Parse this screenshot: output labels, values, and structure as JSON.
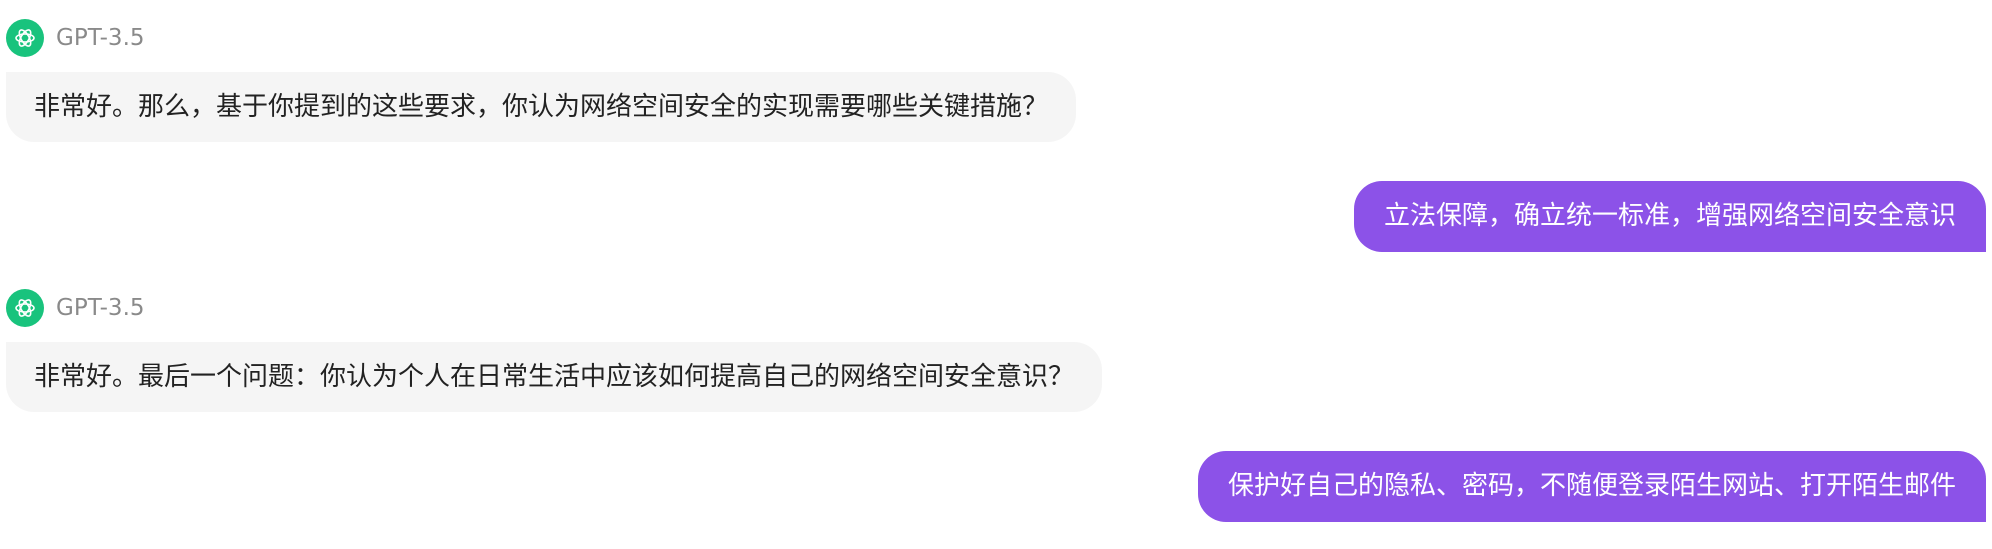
{
  "messages": [
    {
      "role": "assistant",
      "model": "GPT-3.5",
      "avatar_icon": "openai-logo-icon",
      "text": "非常好。那么，基于你提到的这些要求，你认为网络空间安全的实现需要哪些关键措施？"
    },
    {
      "role": "user",
      "text": "立法保障，确立统一标准，增强网络空间安全意识"
    },
    {
      "role": "assistant",
      "model": "GPT-3.5",
      "avatar_icon": "openai-logo-icon",
      "text": "非常好。最后一个问题：你认为个人在日常生活中应该如何提高自己的网络空间安全意识？"
    },
    {
      "role": "user",
      "text": "保护好自己的隐私、密码，不随便登录陌生网站、打开陌生邮件"
    }
  ],
  "colors": {
    "avatar_bg": "#19c37d",
    "assistant_bubble_bg": "#f5f5f5",
    "user_bubble_bg": "#8c52e8",
    "model_label": "#8a8a8a"
  }
}
